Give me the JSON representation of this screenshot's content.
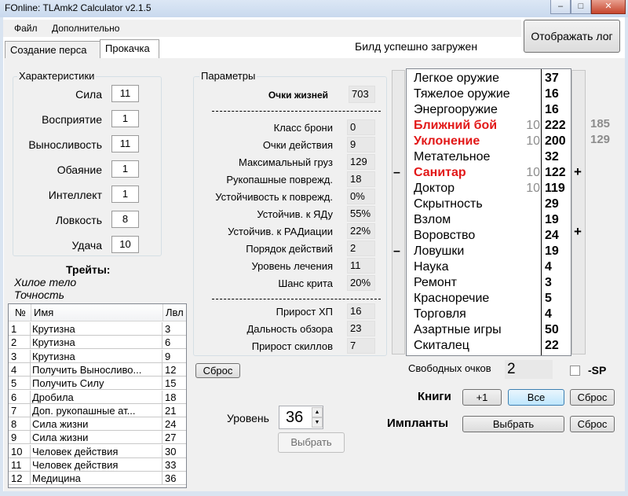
{
  "window": {
    "title": "FOnline: TLAmk2 Calculator  v2.1.5",
    "controls": [
      "–",
      "□",
      "✕"
    ]
  },
  "menu": [
    "Файл",
    "Дополнительно"
  ],
  "tabs": [
    {
      "label": "Создание перса"
    },
    {
      "label": "Прокачка"
    }
  ],
  "status": "Билд успешно загружен",
  "show_log_button": "Отображать лог",
  "characteristics": {
    "label": "Характеристики",
    "items": [
      {
        "name": "Сила",
        "value": "11"
      },
      {
        "name": "Восприятие",
        "value": "1"
      },
      {
        "name": "Выносливость",
        "value": "11"
      },
      {
        "name": "Обаяние",
        "value": "1"
      },
      {
        "name": "Интеллект",
        "value": "1"
      },
      {
        "name": "Ловкость",
        "value": "8"
      },
      {
        "name": "Удача",
        "value": "10"
      }
    ]
  },
  "traits": {
    "label": "Трейты:",
    "items": [
      "Хилое тело",
      "Точность"
    ]
  },
  "perks_table": {
    "columns": [
      "№",
      "Имя",
      "Лвл"
    ],
    "rows": [
      [
        "1",
        "Крутизна",
        "3"
      ],
      [
        "2",
        "Крутизна",
        "6"
      ],
      [
        "3",
        "Крутизна",
        "9"
      ],
      [
        "4",
        "Получить Выносливо...",
        "12"
      ],
      [
        "5",
        "Получить Силу",
        "15"
      ],
      [
        "6",
        "Дробила",
        "18"
      ],
      [
        "7",
        "Доп. рукопашные ат...",
        "21"
      ],
      [
        "8",
        "Сила жизни",
        "24"
      ],
      [
        "9",
        "Сила жизни",
        "27"
      ],
      [
        "10",
        "Человек действия",
        "30"
      ],
      [
        "11",
        "Человек действия",
        "33"
      ],
      [
        "12",
        "Медицина",
        "36"
      ]
    ]
  },
  "parameters": {
    "label": "Параметры",
    "hp": {
      "name": "Очки жизней",
      "value": "703"
    },
    "main": [
      {
        "name": "Класс брони",
        "value": "0"
      },
      {
        "name": "Очки действия",
        "value": "9"
      },
      {
        "name": "Максимальный груз",
        "value": "129"
      },
      {
        "name": "Рукопашные поврежд.",
        "value": "18"
      },
      {
        "name": "Устойчивость к поврежд.",
        "value": "0%"
      },
      {
        "name": "Устойчив. к ЯДу",
        "value": "55%"
      },
      {
        "name": "Устойчив. к РАДиации",
        "value": "22%"
      },
      {
        "name": "Порядок действий",
        "value": "2"
      },
      {
        "name": "Уровень лечения",
        "value": "11"
      },
      {
        "name": "Шанс крита",
        "value": "20%"
      }
    ],
    "growth": [
      {
        "name": "Прирост ХП",
        "value": "16"
      },
      {
        "name": "Дальность обзора",
        "value": "23"
      },
      {
        "name": "Прирост скиллов",
        "value": "7"
      }
    ]
  },
  "reset_button": "Сброс",
  "level": {
    "label": "Уровень",
    "value": "36",
    "select_button": "Выбрать"
  },
  "skills": [
    {
      "name": "Легкое оружие",
      "bonus": "",
      "value": "37",
      "tagged": false
    },
    {
      "name": "Тяжелое оружие",
      "bonus": "",
      "value": "16",
      "tagged": false
    },
    {
      "name": "Энергооружие",
      "bonus": "",
      "value": "16",
      "tagged": false
    },
    {
      "name": "Ближний бой",
      "bonus": "10",
      "value": "222",
      "tagged": true
    },
    {
      "name": "Уклонение",
      "bonus": "10",
      "value": "200",
      "tagged": true
    },
    {
      "name": "Метательное",
      "bonus": "",
      "value": "32",
      "tagged": false
    },
    {
      "name": "Санитар",
      "bonus": "10",
      "value": "122",
      "tagged": true
    },
    {
      "name": "Доктор",
      "bonus": "10",
      "value": "119",
      "tagged": false
    },
    {
      "name": "Скрытность",
      "bonus": "",
      "value": "29",
      "tagged": false
    },
    {
      "name": "Взлом",
      "bonus": "",
      "value": "19",
      "tagged": false
    },
    {
      "name": "Воровство",
      "bonus": "",
      "value": "24",
      "tagged": false
    },
    {
      "name": "Ловушки",
      "bonus": "",
      "value": "19",
      "tagged": false
    },
    {
      "name": "Наука",
      "bonus": "",
      "value": "4",
      "tagged": false
    },
    {
      "name": "Ремонт",
      "bonus": "",
      "value": "3",
      "tagged": false
    },
    {
      "name": "Красноречие",
      "bonus": "",
      "value": "5",
      "tagged": false
    },
    {
      "name": "Торговля",
      "bonus": "",
      "value": "4",
      "tagged": false
    },
    {
      "name": "Азартные игры",
      "bonus": "",
      "value": "50",
      "tagged": false
    },
    {
      "name": "Скиталец",
      "bonus": "",
      "value": "22",
      "tagged": false
    }
  ],
  "skill_side_values": [
    "185",
    "129"
  ],
  "skill_buttons": {
    "minus": "–",
    "plus": "+"
  },
  "free_points": {
    "label": "Свободных очков",
    "value": "2",
    "sp_label": "-SP"
  },
  "books": {
    "label": "Книги",
    "plus_one": "+1",
    "all": "Все",
    "reset": "Сброс"
  },
  "implants": {
    "label": "Импланты",
    "select": "Выбрать",
    "reset": "Сброс"
  },
  "colors": {
    "tag": "#e21818",
    "bonus": "#8c8c8c",
    "panel": "#f0f0f0",
    "focus": "#3c7fb1"
  }
}
